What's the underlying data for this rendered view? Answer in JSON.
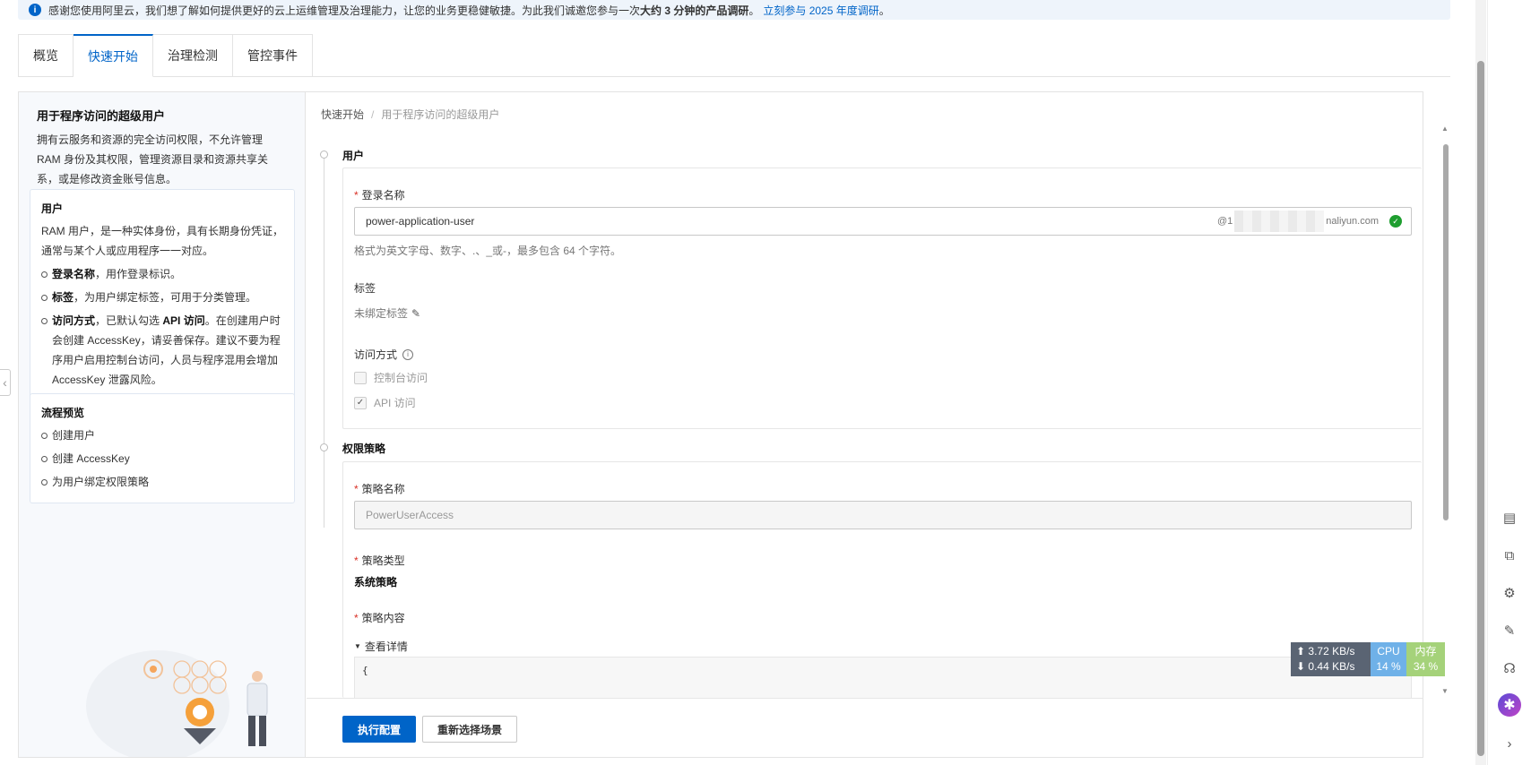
{
  "banner": {
    "text": "感谢您使用阿里云，我们想了解如何提供更好的云上运维管理及治理能力，让您的业务更稳健敏捷。为此我们诚邀您参与一次",
    "bold": "大约 3 分钟的产品调研",
    "punct": "。",
    "link": "立刻参与 2025 年度调研",
    "end": "。"
  },
  "tabs": [
    {
      "label": "概览"
    },
    {
      "label": "快速开始"
    },
    {
      "label": "治理检测"
    },
    {
      "label": "管控事件"
    }
  ],
  "left": {
    "title": "用于程序访问的超级用户",
    "desc": "拥有云服务和资源的完全访问权限，不允许管理 RAM 身份及其权限，管理资源目录和资源共享关系，或是修改资金账号信息。",
    "user_card": {
      "title": "用户",
      "intro": "RAM 用户，是一种实体身份，具有长期身份凭证，通常与某个人或应用程序一一对应。",
      "items": [
        {
          "bold": "登录名称",
          "text": "，用作登录标识。"
        },
        {
          "bold": "标签",
          "text": "，为用户绑定标签，可用于分类管理。"
        },
        {
          "bold": "访问方式",
          "text": "，已默认勾选 ",
          "bold2": "API 访问",
          "text2": "。在创建用户时会创建 AccessKey，请妥善保存。建议不要为程序用户启用控制台访问，人员与程序混用会增加 AccessKey 泄露风险。"
        }
      ]
    },
    "flow_card": {
      "title": "流程预览",
      "items": [
        "创建用户",
        "创建 AccessKey",
        "为用户绑定权限策略"
      ]
    }
  },
  "breadcrumb": {
    "root": "快速开始",
    "sep": "/",
    "current": "用于程序访问的超级用户"
  },
  "user_section": {
    "title": "用户",
    "login_label": "登录名称",
    "login_value": "power-application-user",
    "login_suffix_start": "@1",
    "login_suffix_end": "naliyun.com",
    "login_hint": "格式为英文字母、数字、.、_或-，最多包含 64 个字符。",
    "tag_label": "标签",
    "tag_value": "未绑定标签",
    "access_label": "访问方式",
    "console_access": "控制台访问",
    "api_access": "API 访问"
  },
  "policy_section": {
    "title": "权限策略",
    "name_label": "策略名称",
    "name_placeholder": "PowerUserAccess",
    "type_label": "策略类型",
    "type_value": "系统策略",
    "content_label": "策略内容",
    "details_toggle": "查看详情",
    "code_line": "{"
  },
  "footer": {
    "execute": "执行配置",
    "reselect": "重新选择场景"
  },
  "net_monitor": {
    "up": "3.72 KB/s",
    "down": "0.44 KB/s",
    "cpu_label": "CPU",
    "cpu_value": "14 %",
    "mem_label": "内存",
    "mem_value": "34 %"
  },
  "colors": {
    "accent": "#0064c8",
    "success": "#1e9e2f",
    "required": "#d93026"
  }
}
